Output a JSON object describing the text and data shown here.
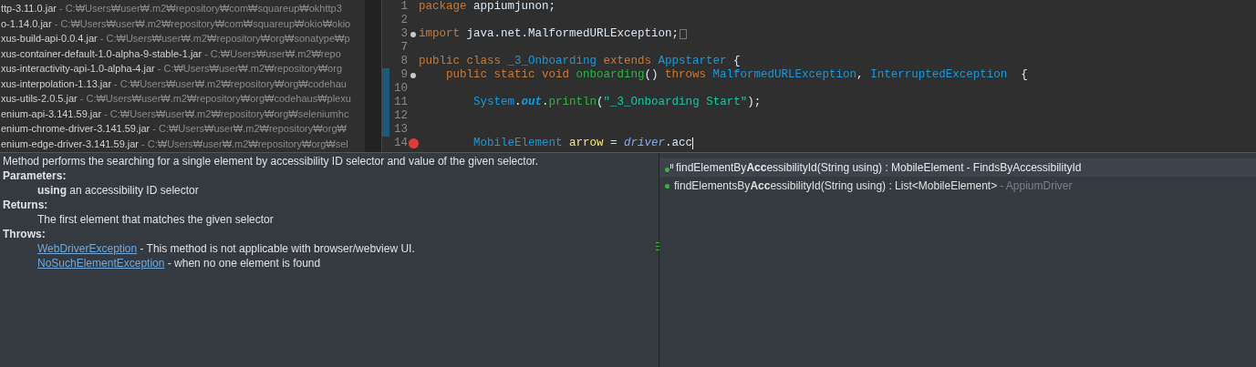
{
  "jar_list": [
    {
      "name": "ttp-3.11.0.jar",
      "path": "- C:₩Users₩user₩.m2₩repository₩com₩squareup₩okhttp3"
    },
    {
      "name": "o-1.14.0.jar",
      "path": "- C:₩Users₩user₩.m2₩repository₩com₩squareup₩okio₩okio"
    },
    {
      "name": "xus-build-api-0.0.4.jar",
      "path": "- C:₩Users₩user₩.m2₩repository₩org₩sonatype₩p"
    },
    {
      "name": "xus-container-default-1.0-alpha-9-stable-1.jar",
      "path": "- C:₩Users₩user₩.m2₩repo"
    },
    {
      "name": "xus-interactivity-api-1.0-alpha-4.jar",
      "path": "- C:₩Users₩user₩.m2₩repository₩org"
    },
    {
      "name": "xus-interpolation-1.13.jar",
      "path": "- C:₩Users₩user₩.m2₩repository₩org₩codehau"
    },
    {
      "name": "xus-utils-2.0.5.jar",
      "path": "- C:₩Users₩user₩.m2₩repository₩org₩codehaus₩plexu"
    },
    {
      "name": "enium-api-3.141.59.jar",
      "path": "- C:₩Users₩user₩.m2₩repository₩org₩seleniumhc"
    },
    {
      "name": "enium-chrome-driver-3.141.59.jar",
      "path": "- C:₩Users₩user₩.m2₩repository₩org₩"
    },
    {
      "name": "enium-edge-driver-3.141.59.jar",
      "path": "- C:₩Users₩user₩.m2₩repository₩org₩sel"
    }
  ],
  "editor": {
    "lines": [
      {
        "number": "1",
        "folding": false,
        "error": false,
        "changed": false,
        "tokens": [
          {
            "kind": "keyword",
            "text": "package"
          },
          {
            "kind": "plain",
            "text": " appiumjunon;"
          }
        ]
      },
      {
        "number": "2",
        "folding": false,
        "error": false,
        "changed": false
      },
      {
        "number": "3",
        "folding": true,
        "error": false,
        "changed": false,
        "collapsed": true,
        "tokens": [
          {
            "kind": "keyword",
            "text": "import"
          },
          {
            "kind": "plain",
            "text": " java.net.MalformedURLException;"
          }
        ]
      },
      {
        "number": "7",
        "folding": false,
        "error": false,
        "changed": false
      },
      {
        "number": "8",
        "folding": false,
        "error": false,
        "changed": false,
        "tokens": [
          {
            "kind": "keyword",
            "text": "public class"
          },
          {
            "kind": "type",
            "text": " _3_Onboarding "
          },
          {
            "kind": "keyword",
            "text": "extends"
          },
          {
            "kind": "type",
            "text": " Appstarter"
          },
          {
            "kind": "plain",
            "text": " {"
          }
        ]
      },
      {
        "number": "9",
        "folding": true,
        "error": false,
        "changed": true,
        "tokens": [
          {
            "kind": "keyword",
            "text": "    public static void"
          },
          {
            "kind": "method",
            "text": " onboarding"
          },
          {
            "kind": "plain",
            "text": "() "
          },
          {
            "kind": "keyword",
            "text": "throws"
          },
          {
            "kind": "type",
            "text": " MalformedURLException"
          },
          {
            "kind": "plain",
            "text": ", "
          },
          {
            "kind": "type",
            "text": "InterruptedException"
          },
          {
            "kind": "plain",
            "text": "  {"
          }
        ]
      },
      {
        "number": "10",
        "folding": false,
        "error": false,
        "changed": true
      },
      {
        "number": "11",
        "folding": false,
        "error": false,
        "changed": true,
        "tokens": [
          {
            "kind": "type",
            "text": "        System"
          },
          {
            "kind": "plain",
            "text": "."
          },
          {
            "kind": "field",
            "text": "out"
          },
          {
            "kind": "plain",
            "text": "."
          },
          {
            "kind": "method",
            "text": "println"
          },
          {
            "kind": "plain",
            "text": "("
          },
          {
            "kind": "string",
            "text": "\"_3_Onboarding Start\""
          },
          {
            "kind": "plain",
            "text": ");"
          }
        ]
      },
      {
        "number": "12",
        "folding": false,
        "error": false,
        "changed": true
      },
      {
        "number": "13",
        "folding": false,
        "error": false,
        "changed": true
      },
      {
        "number": "14",
        "folding": false,
        "error": true,
        "changed": false,
        "tokens": [
          {
            "kind": "type",
            "text": "        MobileElement"
          },
          {
            "kind": "variable",
            "text": " arrow"
          },
          {
            "kind": "plain",
            "text": " = "
          },
          {
            "kind": "static",
            "text": "driver"
          },
          {
            "kind": "plain",
            "text": ".acc"
          }
        ]
      }
    ]
  },
  "javadoc": {
    "summary": "Method performs the searching for a single element by accessibility ID selector and value of the given selector.",
    "sections": [
      {
        "heading": "Parameters:",
        "entries": [
          {
            "kind": "text",
            "text": "**using** an accessibility ID selector"
          }
        ]
      },
      {
        "heading": "Returns:",
        "entries": [
          {
            "kind": "text",
            "text": "The first element that matches the given selector"
          }
        ]
      },
      {
        "heading": "Throws:",
        "entries": [
          {
            "kind": "link",
            "link": "WebDriverException",
            "text": " - This method is not applicable with browser/webview UI."
          },
          {
            "kind": "link",
            "link": "NoSuchElementException",
            "text": " - when no one element is found"
          }
        ]
      }
    ]
  },
  "completions": [
    {
      "label": "findElementBy**Acc**essibilityId(String using) : MobileElement",
      "qualifier": "- FindsByAccessibilityId",
      "selected": true,
      "kind": "default-method"
    },
    {
      "label": "findElementsBy**Acc**essibilityId(String using) : List<MobileElement>",
      "qualifier": "- AppiumDriver",
      "selected": false,
      "kind": "public-method"
    }
  ]
}
